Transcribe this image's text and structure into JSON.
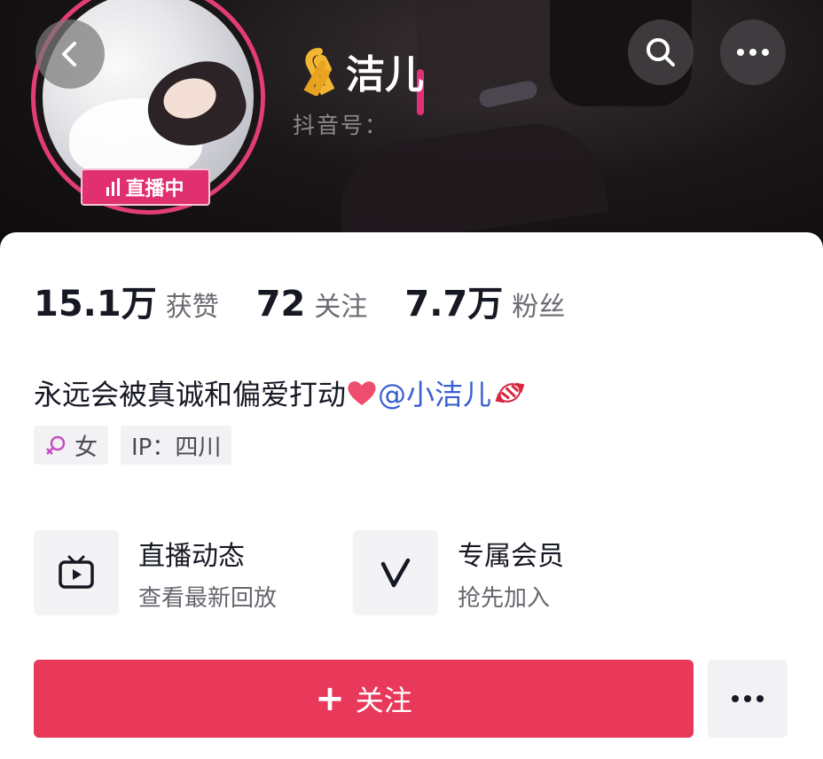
{
  "profile": {
    "name": "洁儿",
    "douyin_id_label": "抖音号：",
    "live_label": "直播中",
    "bio_text": "永远会被真诚和偏爱打动",
    "bio_mention": "@小洁儿",
    "gender": "女",
    "ip": "IP：四川"
  },
  "stats": [
    {
      "value": "15.1万",
      "label": "获赞"
    },
    {
      "value": "72",
      "label": "关注"
    },
    {
      "value": "7.7万",
      "label": "粉丝"
    }
  ],
  "features": [
    {
      "title": "直播动态",
      "subtitle": "查看最新回放",
      "icon": "tv-icon"
    },
    {
      "title": "专属会员",
      "subtitle": "抢先加入",
      "icon": "v-icon"
    }
  ],
  "actions": {
    "follow_label": "关注",
    "follow_plus": "+"
  },
  "colors": {
    "accent": "#e8395a",
    "live_badge": "#e0306f",
    "ring": "#e23d74",
    "mention": "#3a5fcf"
  },
  "icons": [
    "back-icon",
    "search-icon",
    "more-icon",
    "ribbon-icon",
    "live-bars-icon",
    "female-icon",
    "heart-icon",
    "candy-icon",
    "tv-icon",
    "v-icon"
  ]
}
